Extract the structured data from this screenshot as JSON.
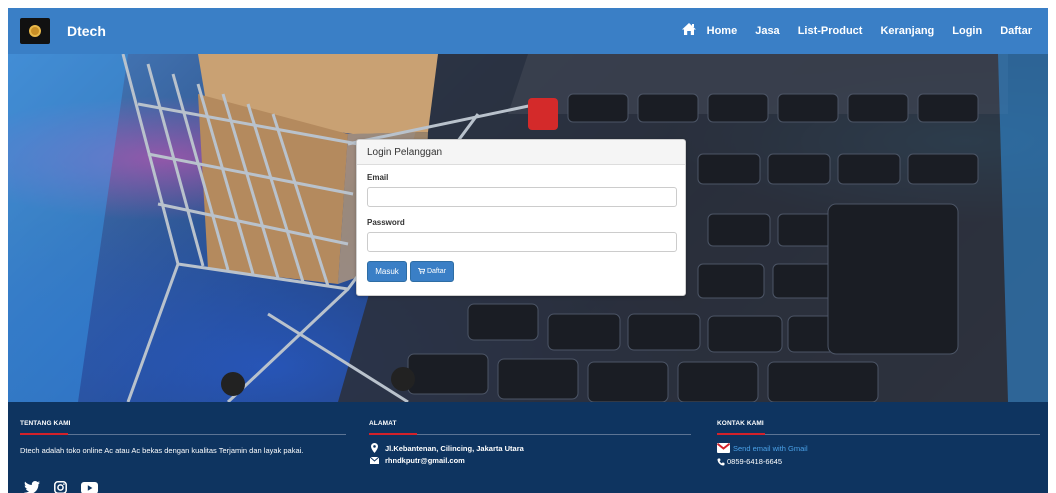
{
  "navbar": {
    "brand": "Dtech",
    "items": [
      "Home",
      "Jasa",
      "List-Product",
      "Keranjang",
      "Login",
      "Daftar"
    ]
  },
  "login": {
    "title": "Login Pelanggan",
    "email_label": "Email",
    "email_value": "",
    "password_label": "Password",
    "password_value": "",
    "submit_label": "Masuk",
    "register_label": "Daftar"
  },
  "footer": {
    "about": {
      "title": "TENTANG KAMI",
      "text": "Dtech adalah toko online Ac atau Ac bekas dengan kualitas Terjamin dan layak pakai."
    },
    "address": {
      "title": "ALAMAT",
      "street": "Jl.Kebantenan, Cilincing, Jakarta Utara",
      "email": "rhndkputr@gmail.com"
    },
    "contact": {
      "title": "KONTAK KAMI",
      "gmail_link": "Send email with Gmail",
      "phone": "0859-6418-6645"
    },
    "social": [
      "twitter-icon",
      "instagram-icon",
      "youtube-icon"
    ]
  },
  "colors": {
    "navbar": "#3a7fc6",
    "footer": "#0e3460",
    "accent": "#d3212a",
    "button": "#3a7fc6"
  }
}
